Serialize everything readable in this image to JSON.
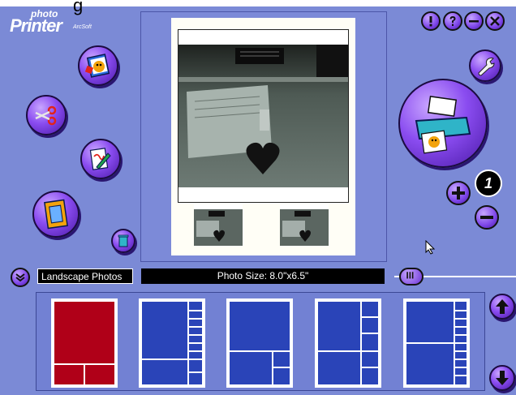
{
  "app": {
    "logo_photo": "photo",
    "logo_printer": "Printer",
    "logo_brand": "ArcSoft",
    "top_fragment": "g"
  },
  "window_controls": [
    {
      "name": "info-icon",
      "glyph": "!"
    },
    {
      "name": "help-icon",
      "glyph": "?"
    },
    {
      "name": "minimize-icon",
      "glyph": "–"
    },
    {
      "name": "close-icon",
      "glyph": "✕"
    }
  ],
  "tools": [
    {
      "name": "get-photo-button",
      "icon": "photo-icon"
    },
    {
      "name": "crop-button",
      "icon": "scissors-icon"
    },
    {
      "name": "edit-button",
      "icon": "edit-pen-icon"
    },
    {
      "name": "frame-button",
      "icon": "frame-icon"
    }
  ],
  "print": {
    "copies": "1",
    "icon": "printer-icon"
  },
  "status": {
    "category": "Landscape Photos",
    "photo_size": "Photo Size: 8.0\"x6.5\""
  },
  "slider": {
    "level": 0.05
  },
  "layouts": [
    {
      "name": "layout-1",
      "selected": true
    },
    {
      "name": "layout-2",
      "selected": false
    },
    {
      "name": "layout-3",
      "selected": false
    },
    {
      "name": "layout-4",
      "selected": false
    },
    {
      "name": "layout-5",
      "selected": false
    }
  ],
  "colors": {
    "background": "#7b8ad6",
    "button_purple": "#8a4cf0",
    "selected_layout": "#b00018",
    "layout_blue": "#2a44b8"
  }
}
